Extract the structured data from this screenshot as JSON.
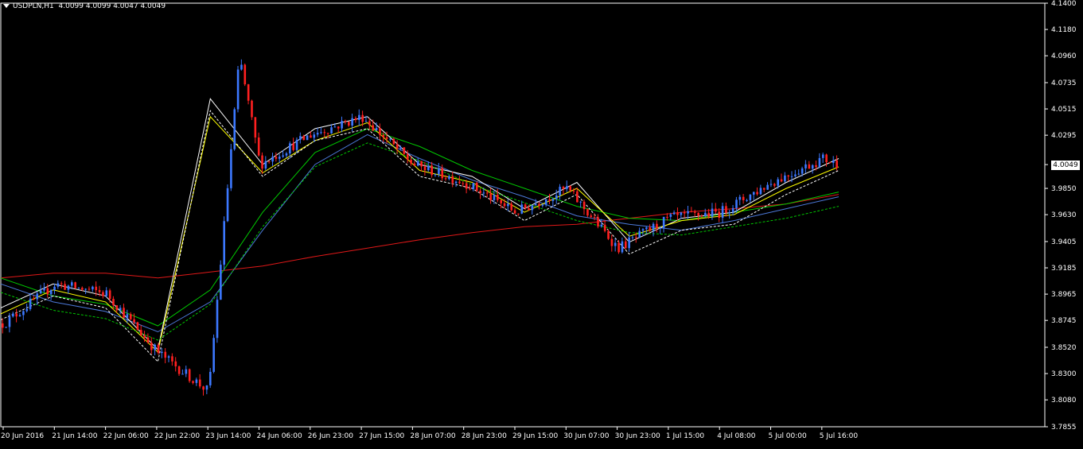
{
  "header": {
    "symbol_tf": "USDPLN,H1",
    "ohlc": "4.0099 4.0099 4.0047 4.0049"
  },
  "current_price": "4.0049",
  "colors": {
    "background": "#000000",
    "axis": "#ffffff",
    "bull_candle": "#3c78ff",
    "bear_candle": "#ff2020",
    "ma_red": "#e01818",
    "ma_green": "#00c800",
    "ma_blue": "#4c78d8",
    "ma_white": "#ffffff",
    "ma_yellow": "#ffff00",
    "band_dashed_white": "#ffffff",
    "band_dashed_green": "#00c800"
  },
  "chart_data": {
    "type": "line",
    "title": "USDPLN,H1",
    "y_ticks": [
      "4.1400",
      "4.1180",
      "4.0960",
      "4.0735",
      "4.0515",
      "4.0295",
      "4.0049",
      "3.9850",
      "3.9630",
      "3.9405",
      "3.9185",
      "3.8965",
      "3.8745",
      "3.8520",
      "3.8300",
      "3.8080",
      "3.7855"
    ],
    "x_ticks": [
      "20 Jun 2016",
      "21 Jun 14:00",
      "22 Jun 06:00",
      "22 Jun 22:00",
      "23 Jun 14:00",
      "24 Jun 06:00",
      "26 Jun 23:00",
      "27 Jun 15:00",
      "28 Jun 07:00",
      "28 Jun 23:00",
      "29 Jun 15:00",
      "30 Jun 07:00",
      "30 Jun 23:00",
      "1 Jul 15:00",
      "4 Jul 08:00",
      "5 Jul 00:00",
      "5 Jul 16:00"
    ],
    "ylim": [
      3.7855,
      4.14
    ],
    "close_anchors": [
      [
        "20 Jun 2016",
        3.872
      ],
      [
        "21 Jun 14:00",
        3.905
      ],
      [
        "22 Jun 06:00",
        3.897
      ],
      [
        "22 Jun 22:00",
        3.848
      ],
      [
        "23 Jun 14:00",
        3.815
      ],
      [
        "23 Jun 22:00",
        4.095
      ],
      [
        "24 Jun 06:00",
        4.005
      ],
      [
        "26 Jun 23:00",
        4.03
      ],
      [
        "27 Jun 15:00",
        4.045
      ],
      [
        "28 Jun 07:00",
        4.005
      ],
      [
        "28 Jun 23:00",
        3.99
      ],
      [
        "29 Jun 15:00",
        3.965
      ],
      [
        "30 Jun 07:00",
        3.985
      ],
      [
        "30 Jun 23:00",
        3.935
      ],
      [
        "1 Jul 15:00",
        3.96
      ],
      [
        "4 Jul 08:00",
        3.965
      ],
      [
        "5 Jul 00:00",
        3.99
      ],
      [
        "5 Jul 16:00",
        4.01
      ],
      [
        "5 Jul 22:00",
        4.005
      ]
    ],
    "series": [
      {
        "values": [
          3.91,
          3.914,
          3.914,
          3.91,
          3.915,
          3.92,
          3.928,
          3.935,
          3.942,
          3.948,
          3.953,
          3.955,
          3.96,
          3.965,
          3.968,
          3.972,
          3.98
        ]
      },
      {
        "values": [
          3.91,
          3.895,
          3.888,
          3.87,
          3.9,
          3.965,
          4.015,
          4.035,
          4.02,
          4.0,
          3.985,
          3.97,
          3.96,
          3.958,
          3.965,
          3.972,
          3.982
        ]
      },
      {
        "values": [
          3.905,
          3.89,
          3.882,
          3.865,
          3.89,
          3.95,
          4.005,
          4.03,
          4.01,
          3.992,
          3.978,
          3.962,
          3.955,
          3.95,
          3.958,
          3.968,
          3.978
        ]
      },
      {
        "values": [
          3.885,
          3.905,
          3.895,
          3.85,
          4.06,
          4.005,
          4.035,
          4.045,
          4.005,
          3.995,
          3.968,
          3.99,
          3.94,
          3.96,
          3.965,
          3.99,
          4.01
        ]
      },
      {
        "values": [
          3.88,
          3.9,
          3.89,
          3.848,
          4.045,
          3.998,
          4.025,
          4.04,
          4.0,
          3.99,
          3.965,
          3.985,
          3.945,
          3.958,
          3.963,
          3.985,
          4.003
        ]
      }
    ]
  }
}
